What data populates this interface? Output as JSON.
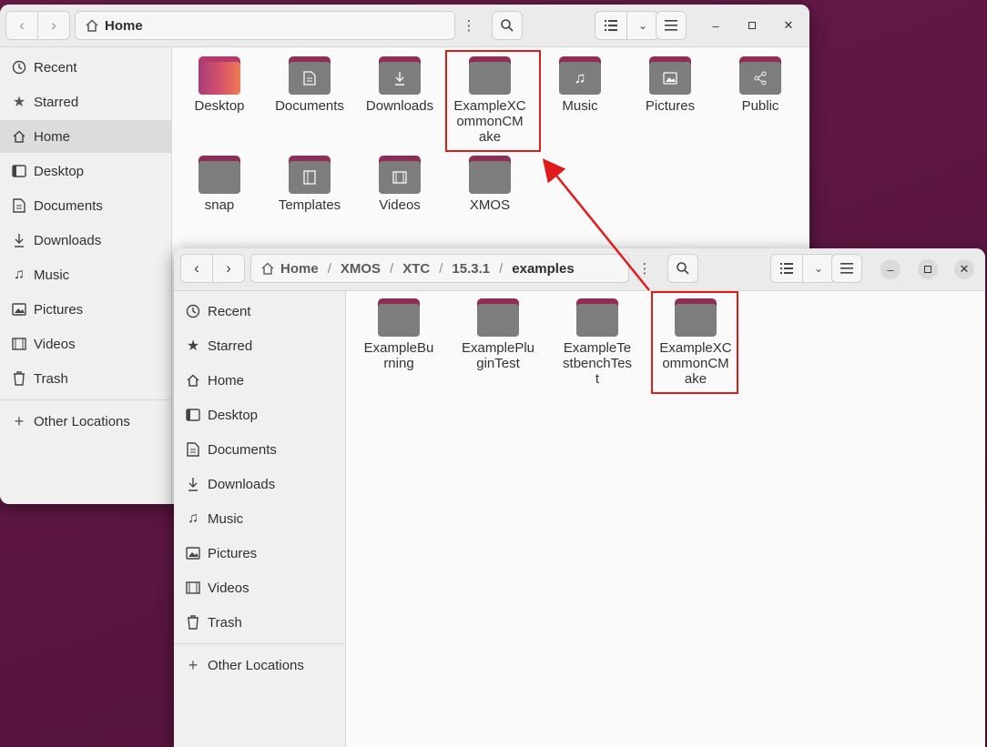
{
  "window1": {
    "path": [
      "Home"
    ],
    "sidebar": [
      {
        "label": "Recent",
        "icon": "clock-icon"
      },
      {
        "label": "Starred",
        "icon": "star-icon"
      },
      {
        "label": "Home",
        "icon": "home-icon",
        "active": true
      },
      {
        "label": "Desktop",
        "icon": "desktop-icon"
      },
      {
        "label": "Documents",
        "icon": "document-icon"
      },
      {
        "label": "Downloads",
        "icon": "download-icon"
      },
      {
        "label": "Music",
        "icon": "music-icon"
      },
      {
        "label": "Pictures",
        "icon": "picture-icon"
      },
      {
        "label": "Videos",
        "icon": "film-icon"
      },
      {
        "label": "Trash",
        "icon": "trash-icon"
      }
    ],
    "other_locations": "Other Locations",
    "folders": [
      {
        "label": "Desktop",
        "icon": "desktop-folder"
      },
      {
        "label": "Documents",
        "icon": "document-icon"
      },
      {
        "label": "Downloads",
        "icon": "download-icon"
      },
      {
        "label": "ExampleXC ommonCM ake",
        "icon": "plain-folder",
        "highlighted": true
      },
      {
        "label": "Music",
        "icon": "music-icon"
      },
      {
        "label": "Pictures",
        "icon": "picture-icon"
      },
      {
        "label": "Public",
        "icon": "share-icon"
      },
      {
        "label": "snap",
        "icon": "plain-folder"
      },
      {
        "label": "Templates",
        "icon": "template-icon"
      },
      {
        "label": "Videos",
        "icon": "film-icon"
      },
      {
        "label": "XMOS",
        "icon": "plain-folder"
      }
    ]
  },
  "window2": {
    "path": [
      "Home",
      "XMOS",
      "XTC",
      "15.3.1",
      "examples"
    ],
    "sidebar": [
      {
        "label": "Recent",
        "icon": "clock-icon"
      },
      {
        "label": "Starred",
        "icon": "star-icon"
      },
      {
        "label": "Home",
        "icon": "home-icon"
      },
      {
        "label": "Desktop",
        "icon": "desktop-icon"
      },
      {
        "label": "Documents",
        "icon": "document-icon"
      },
      {
        "label": "Downloads",
        "icon": "download-icon"
      },
      {
        "label": "Music",
        "icon": "music-icon"
      },
      {
        "label": "Pictures",
        "icon": "picture-icon"
      },
      {
        "label": "Videos",
        "icon": "film-icon"
      },
      {
        "label": "Trash",
        "icon": "trash-icon"
      }
    ],
    "other_locations": "Other Locations",
    "folders": [
      {
        "label": "ExampleBu rning"
      },
      {
        "label": "ExamplePlu ginTest"
      },
      {
        "label": "ExampleTe stbenchTes t"
      },
      {
        "label": "ExampleXC ommonCM ake",
        "highlighted": true
      }
    ]
  },
  "annotation": {
    "color": "#e01b1b"
  }
}
